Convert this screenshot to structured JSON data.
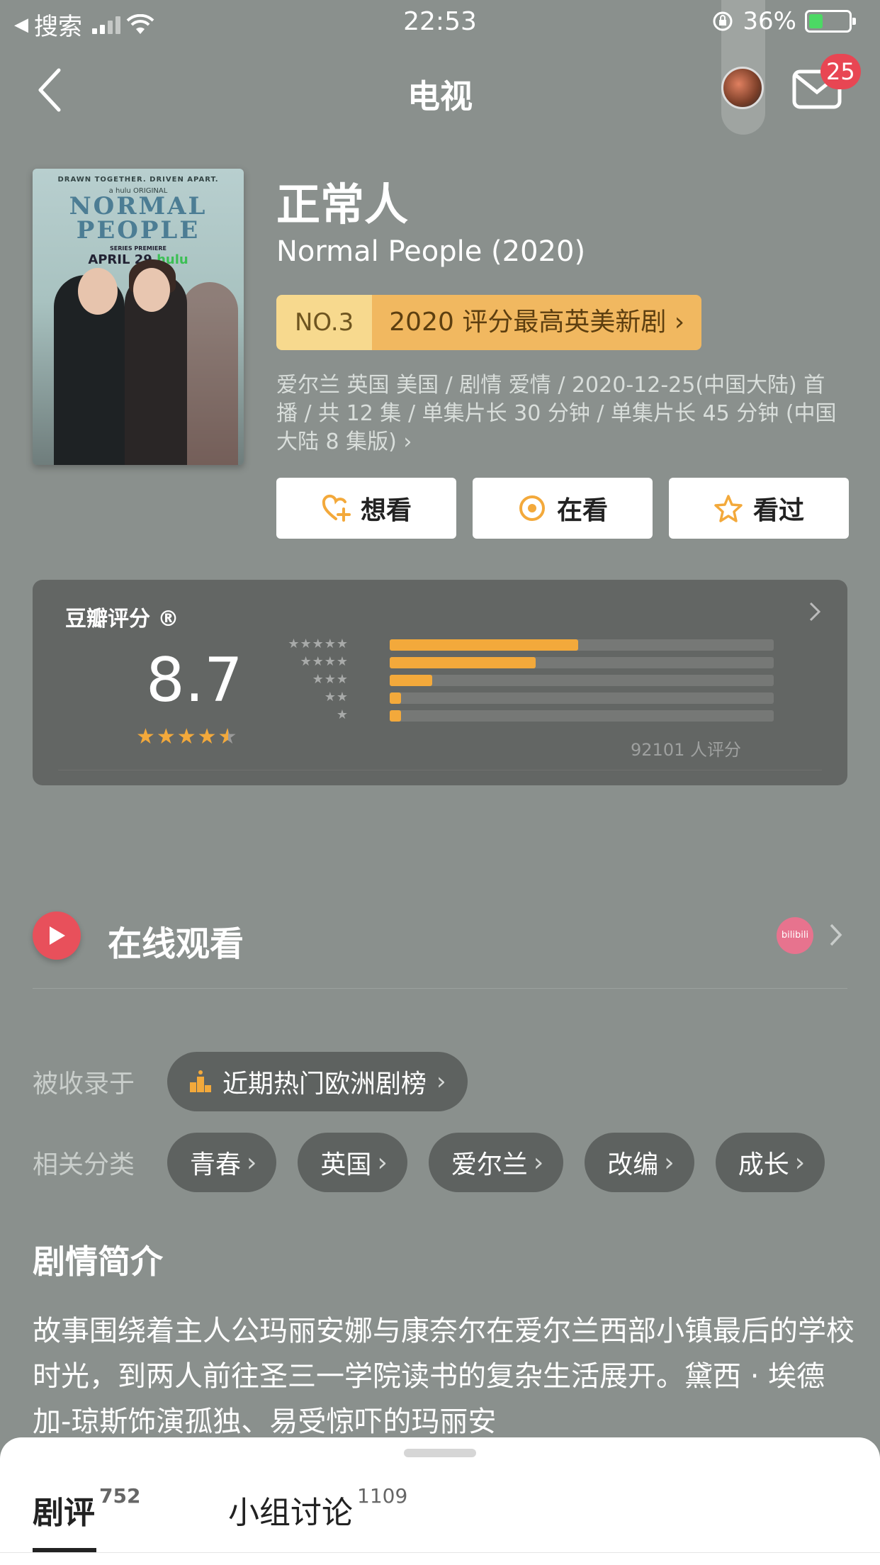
{
  "status_bar": {
    "back_app": "搜索",
    "time": "22:53",
    "battery_percent": "36%",
    "battery_level": 0.36
  },
  "nav": {
    "title": "电视",
    "mail_badge": "25"
  },
  "subject": {
    "title_cn": "正常人",
    "title_en": "Normal People (2020)",
    "rank_no": "NO.3",
    "rank_text": "2020 评分最高英美新剧 ›",
    "meta": "爱尔兰 英国 美国 / 剧情 爱情 / 2020-12-25(中国大陆) 首播 / 共 12 集 / 单集片长 30 分钟 / 单集片长 45 分钟 (中国大陆 8 集版) ›"
  },
  "poster": {
    "tagline": "DRAWN TOGETHER. DRIVEN APART.",
    "original": "a hulu ORIGINAL",
    "title_line1": "NORMAL",
    "title_line2": "PEOPLE",
    "series_premiere": "SERIES PREMIERE",
    "date": "APRIL 29",
    "brand": "hulu"
  },
  "actions": {
    "want": "想看",
    "watching": "在看",
    "watched": "看过"
  },
  "rating": {
    "label": "豆瓣评分 ®",
    "score": "8.7",
    "count_text": "92101 人评分",
    "distribution": [
      {
        "stars": "★★★★★",
        "fraction": 0.49
      },
      {
        "stars": "★★★★",
        "fraction": 0.38
      },
      {
        "stars": "★★★",
        "fraction": 0.11
      },
      {
        "stars": "★★",
        "fraction": 0.03
      },
      {
        "stars": "★",
        "fraction": 0.03
      }
    ],
    "colors": {
      "accent": "#f3a93b"
    }
  },
  "watch_online": {
    "label": "在线观看",
    "platform_icon": "bilibili-icon"
  },
  "collected": {
    "label": "被收录于",
    "list_name": "近期热门欧洲剧榜"
  },
  "tags": {
    "label": "相关分类",
    "items": [
      "青春",
      "英国",
      "爱尔兰",
      "改编",
      "成长"
    ]
  },
  "synopsis": {
    "title": "剧情简介",
    "text": "故事围绕着主人公玛丽安娜与康奈尔在爱尔兰西部小镇最后的学校时光，到两人前往圣三一学院读书的复杂生活展开。黛西 · 埃德加-琼斯饰演孤独、易受惊吓的玛丽安"
  },
  "bottom_sheet": {
    "tab1": "剧评",
    "tab1_count": "752",
    "tab2": "小组讨论",
    "tab2_count": "1109"
  }
}
